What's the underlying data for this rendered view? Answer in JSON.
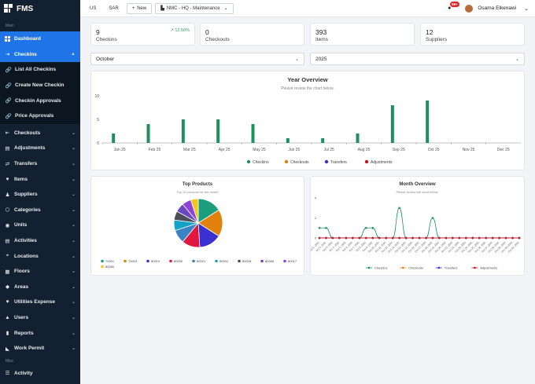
{
  "app": {
    "title": "FMS"
  },
  "sidebar": {
    "section_main": "Main",
    "section_misc": "Misc",
    "dashboard": "Dashboard",
    "checkins": "Checkins",
    "checkins_sub": [
      "List All Checkins",
      "Create New Checkin",
      "Checkin Approvals",
      "Price Approvals"
    ],
    "items": [
      "Checkouts",
      "Adjustments",
      "Transfers",
      "Items",
      "Suppliers",
      "Categories",
      "Units",
      "Activities",
      "Locations",
      "Floors",
      "Areas",
      "Utilities Expense",
      "Users",
      "Reports",
      "Work Permit"
    ],
    "activity": "Activity"
  },
  "topbar": {
    "lang": "US",
    "currency": "SAR",
    "new_label": "New",
    "location": "NMC - HQ - Maintenance",
    "notif_count": "99+",
    "user_name": "Osama Elkenawi"
  },
  "stats": [
    {
      "value": "9",
      "label": "Checkins",
      "trend": "12.50%"
    },
    {
      "value": "0",
      "label": "Checkouts"
    },
    {
      "value": "393",
      "label": "Items"
    },
    {
      "value": "12",
      "label": "Suppliers"
    }
  ],
  "filters": {
    "month": "October",
    "year": "2025"
  },
  "colors": {
    "checkins": "#1f8f5f",
    "checkouts": "#e0820d",
    "transfers": "#3a2fd0",
    "adjustments": "#c8151c",
    "accent": "#1f74e8"
  },
  "year_overview": {
    "title": "Year Overview",
    "subtitle": "Please review the chart below.",
    "chart_data": {
      "type": "bar",
      "categories": [
        "Jan 25",
        "Feb 25",
        "Mar 25",
        "Apr 25",
        "May 25",
        "Jun 25",
        "Jul 25",
        "Aug 25",
        "Sep 25",
        "Oct 25",
        "Nov 25",
        "Dec 25"
      ],
      "y_ticks": [
        "0",
        "5",
        "10"
      ],
      "ylim": [
        0,
        10
      ],
      "series": [
        {
          "name": "Checkins",
          "values": [
            2,
            4,
            5,
            5,
            4,
            1,
            1,
            2,
            8,
            9,
            0,
            0
          ]
        },
        {
          "name": "Checkouts",
          "values": [
            0,
            0,
            0,
            0,
            0,
            0,
            0,
            0,
            0,
            0,
            0,
            0
          ]
        },
        {
          "name": "Transfers",
          "values": [
            0,
            0,
            0,
            0,
            0,
            0,
            0,
            0,
            0,
            0,
            0,
            0
          ]
        },
        {
          "name": "Adjustments",
          "values": [
            0,
            0,
            0,
            0,
            0,
            0,
            0,
            0,
            0,
            0,
            0,
            0
          ]
        }
      ]
    }
  },
  "top_products": {
    "title": "Top Products",
    "subtitle": "Top 10 products for the month",
    "chart_data": {
      "type": "pie",
      "labels": [
        "70001",
        "70015",
        "80019",
        "80030",
        "80021",
        "80001",
        "80028",
        "80089",
        "80017",
        "80080"
      ],
      "values": [
        16,
        18,
        15,
        12,
        9,
        7,
        6,
        6,
        6,
        5
      ],
      "colors": [
        "#1a9e7c",
        "#e0820d",
        "#3a2fd0",
        "#c8151c",
        "#2a57d6",
        "#ffffff",
        "#555c66",
        "#7a49c9",
        "#2aa6a0",
        "#f0c419"
      ],
      "slice_colors": [
        "#1a9e7c",
        "#e0820d",
        "#3a2fd0",
        "#e0183f",
        "#3b82c4",
        "#12a2c6",
        "#4a4f57",
        "#6b46c1",
        "#8f42d6",
        "#f2c81c"
      ]
    }
  },
  "month_overview": {
    "title": "Month Overview",
    "subtitle": "Please review the chart below.",
    "chart_data": {
      "type": "line",
      "x": [
        "Oct 1, 2025",
        "Oct 2, 2025",
        "Oct 3, 2025",
        "Oct 4, 2025",
        "Oct 5, 2025",
        "Oct 6, 2025",
        "Oct 7, 2025",
        "Oct 8, 2025",
        "Oct 9, 2025",
        "Oct 10, 2025",
        "Oct 11, 2025",
        "Oct 12, 2025",
        "Oct 13, 2025",
        "Oct 14, 2025",
        "Oct 15, 2025",
        "Oct 16, 2025",
        "Oct 17, 2025",
        "Oct 18, 2025",
        "Oct 19, 2025",
        "Oct 20, 2025",
        "Oct 21, 2025",
        "Oct 22, 2025",
        "Oct 23, 2025",
        "Oct 24, 2025",
        "Oct 25, 2025",
        "Oct 26, 2025",
        "Oct 27, 2025",
        "Oct 28, 2025",
        "Oct 29, 2025",
        "Oct 30, 2025",
        "Oct 31, 2025"
      ],
      "y_ticks": [
        "0",
        "2",
        "4"
      ],
      "ylim": [
        0,
        4
      ],
      "series": [
        {
          "name": "Checkins",
          "values": [
            1,
            1,
            0,
            0,
            0,
            0,
            0,
            1,
            1,
            0,
            0,
            0,
            3,
            0,
            0,
            0,
            0,
            2,
            0,
            0,
            0,
            0,
            0,
            0,
            0,
            0,
            0,
            0,
            0,
            0,
            0
          ]
        },
        {
          "name": "Checkouts",
          "values": [
            0,
            0,
            0,
            0,
            0,
            0,
            0,
            0,
            0,
            0,
            0,
            0,
            0,
            0,
            0,
            0,
            0,
            0,
            0,
            0,
            0,
            0,
            0,
            0,
            0,
            0,
            0,
            0,
            0,
            0,
            0
          ]
        },
        {
          "name": "Transfers",
          "values": [
            0,
            0,
            0,
            0,
            0,
            0,
            0,
            0,
            0,
            0,
            0,
            0,
            0,
            0,
            0,
            0,
            0,
            0,
            0,
            0,
            0,
            0,
            0,
            0,
            0,
            0,
            0,
            0,
            0,
            0,
            0
          ]
        },
        {
          "name": "Adjustments",
          "values": [
            0,
            0,
            0,
            0,
            0,
            0,
            0,
            0,
            0,
            0,
            0,
            0,
            0,
            0,
            0,
            0,
            0,
            0,
            0,
            0,
            0,
            0,
            0,
            0,
            0,
            0,
            0,
            0,
            0,
            0,
            0
          ]
        }
      ]
    }
  }
}
